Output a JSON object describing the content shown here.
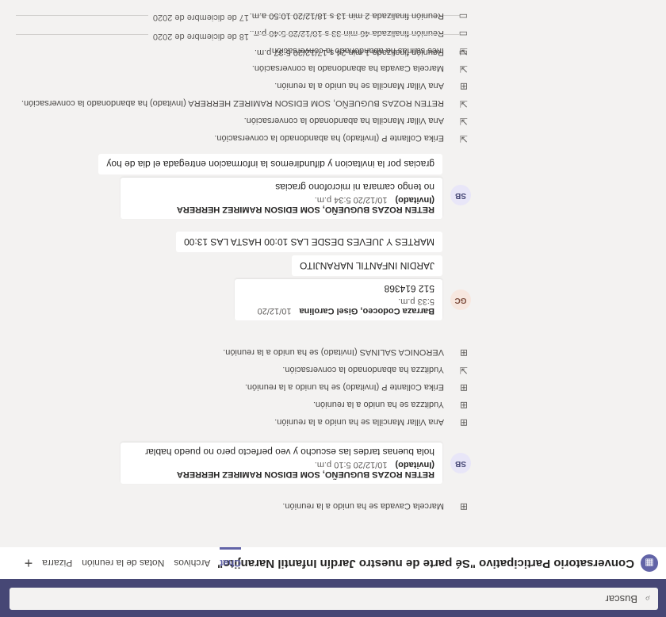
{
  "search": {
    "placeholder": "Buscar"
  },
  "meeting": {
    "title": "Conversatorio Participativo \"Sé parte de nuestro Jardín Infantil Naranjito\"",
    "tabs": [
      "Chat",
      "Archivos",
      "Notas de la reunión",
      "Pizarra"
    ],
    "active_tab": "Chat"
  },
  "feed": {
    "sys1": "Marcela Cavada se ha unido a la reunión.",
    "msg1": {
      "avatar": "SB",
      "sender": "RETEN ROZAS BUGUEÑO, SOM EDISON RAMIREZ HERRERA (Invitado)",
      "time": "10/12/20 5:10 p.m.",
      "text": "hola buenas tardes las escucho y veo perfecto pero no puedo hablar"
    },
    "sys2": "Ana Villar Mancilla se ha unido a la reunión.",
    "sys3": "Yuditzza se ha unido a la reunión.",
    "sys4": "Erika Collante P (Invitado) se ha unido a la reunión.",
    "sys5": "Yuditzza ha abandonado la conversación.",
    "sys6": "VERONICA SALINAS (Invitado) se ha unido a la reunión.",
    "msg2": {
      "avatar": "GC",
      "sender": "Barraza Codoceo, Gisel Carolina",
      "time": "10/12/20 5:33 p.m.",
      "text": "512 614368"
    },
    "msg2_line2": "JARDIN INFANTIL NARANJITO",
    "msg2_line3": "MARTES Y JUEVES DESDE LAS 10:00 HASTA LAS 13:00",
    "msg3": {
      "avatar": "SB",
      "sender": "RETEN ROZAS BUGUEÑO, SOM EDISON RAMIREZ HERRERA (Invitado)",
      "time": "10/12/20 5:34 p.m.",
      "text": "no tengo camara ni  microfono gracias"
    },
    "msg3_line2": "gracias por la invitacion y difundiremos la informacion entregada el  dia de hoy",
    "sys7": "Erika Collante P (Invitado) ha abandonado la conversación.",
    "sys8": "Ana Villar Mancilla ha abandonado la conversación.",
    "sys9": "RETEN ROZAS BUGUEÑO, SOM EDISON RAMIREZ HERRERA (Invitado) ha abandonado la conversación.",
    "sys10": "Ana Villar Mancilla se ha unido a la reunión.",
    "sys11": "Marcela Cavada ha abandonado la conversación.",
    "sys12": "Inés salinas ha abandonado la conversación.",
    "meeting1": "Reunión finalizada  46 min 33 s     10/12/20 5:40 p.m.",
    "date1": "17 de diciembre de 2020",
    "meeting2": "Reunión finalizada  1 min 24 s     17/12/20 5:37 p.m.",
    "date2": "18 de diciembre de 2020",
    "meeting3": "Reunión finalizada  2 min 13 s     18/12/20 10:50 a.m."
  },
  "icons": {
    "join": "person-add-icon",
    "leave": "person-leave-icon",
    "meeting": "video-camera-icon",
    "search": "search-icon"
  },
  "colors": {
    "brand": "#464775",
    "accent": "#6264a7",
    "feed_bg": "#f3f2f1"
  }
}
